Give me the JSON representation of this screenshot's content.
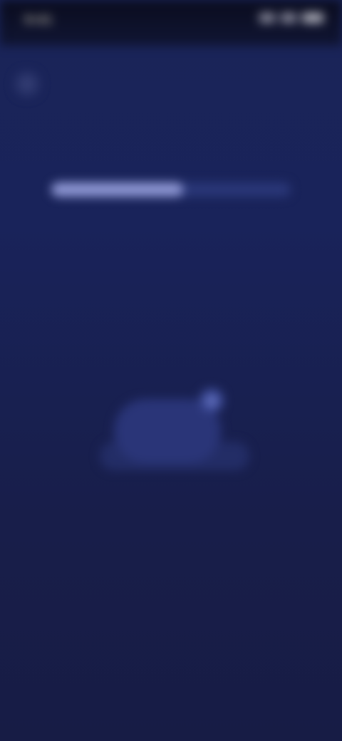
{
  "status_bar": {
    "time": "9:41",
    "icons": [
      "signal-icon",
      "wifi-icon",
      "battery-icon"
    ]
  },
  "header": {
    "back_icon": "chevron-left-icon",
    "title": "",
    "subtitle": ""
  },
  "progress": {
    "value": 0.55
  },
  "illustration": {
    "icon": "cloud-icon"
  },
  "colors": {
    "background": "#19235a",
    "status_bar": "#0c0f26",
    "progress_track": "#2a3778",
    "progress_fill": "#8e97d4",
    "accent": "#6a78c4"
  }
}
